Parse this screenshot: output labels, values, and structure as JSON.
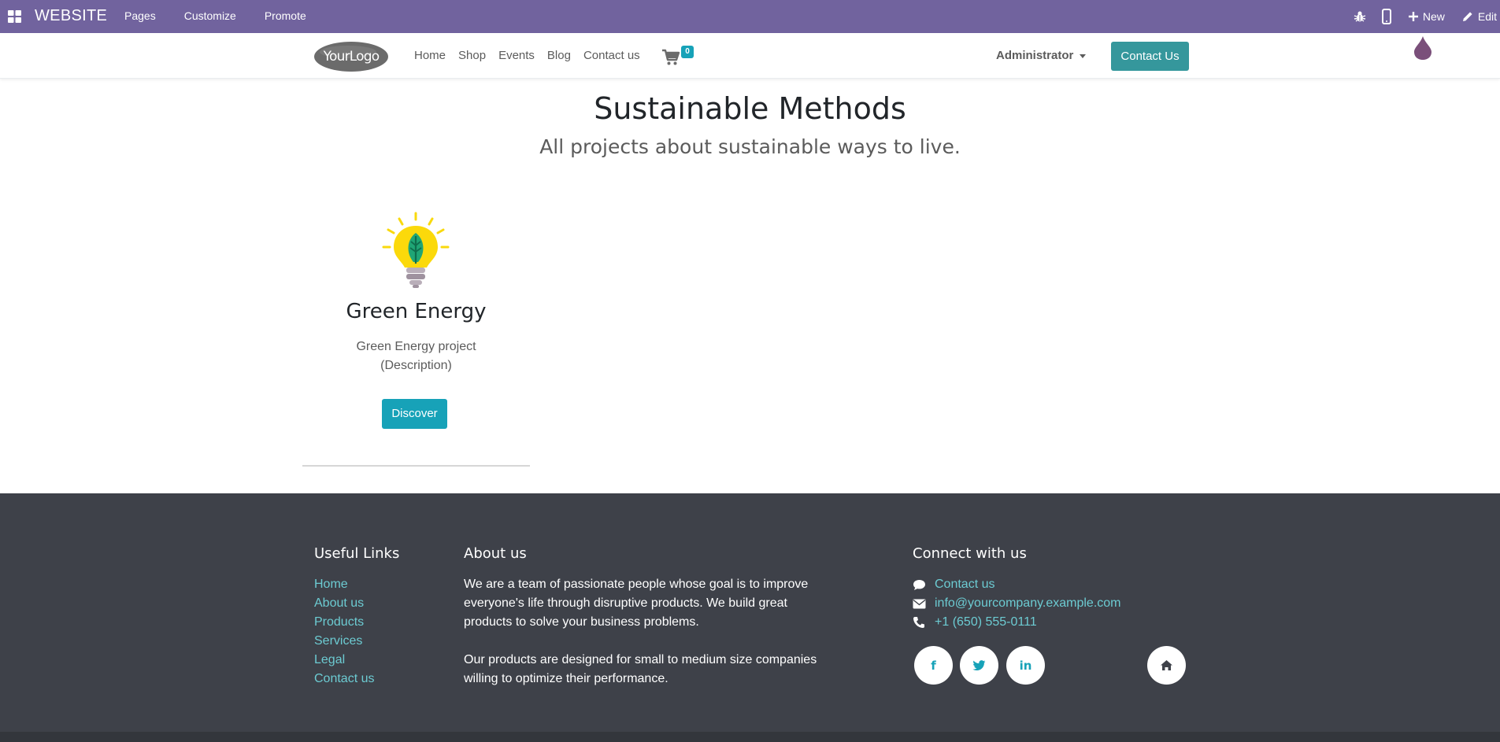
{
  "admin_bar": {
    "app_name": "WEBSITE",
    "menu": [
      "Pages",
      "Customize",
      "Promote"
    ],
    "new_label": "New",
    "edit_label": "Edit"
  },
  "header": {
    "logo_text": "YourLogo",
    "nav": [
      "Home",
      "Shop",
      "Events",
      "Blog",
      "Contact us"
    ],
    "cart_count": "0",
    "user": "Administrator",
    "cta": "Contact Us"
  },
  "main": {
    "title": "Sustainable Methods",
    "subtitle": "All projects about sustainable ways to live.",
    "card": {
      "title": "Green Energy",
      "description_line1": "Green Energy project",
      "description_line2": "(Description)",
      "button": "Discover"
    }
  },
  "footer": {
    "useful_links_title": "Useful Links",
    "useful_links": [
      "Home",
      "About us",
      "Products",
      "Services",
      "Legal",
      "Contact us"
    ],
    "about_title": "About us",
    "about_p1": "We are a team of passionate people whose goal is to improve everyone's life through disruptive products. We build great products to solve your business problems.",
    "about_p2": "Our products are designed for small to medium size companies willing to optimize their performance.",
    "connect_title": "Connect with us",
    "contact_link": "Contact us",
    "email": "info@yourcompany.example.com",
    "phone": "+1 (650) 555-0111",
    "social_facebook": "f",
    "social_linkedin": "in"
  },
  "colors": {
    "admin_bar": "#71639e",
    "accent": "#17a2b8",
    "cta": "#35979c",
    "footer_bg": "#3e4149",
    "footer_link": "#6ccbd2"
  }
}
